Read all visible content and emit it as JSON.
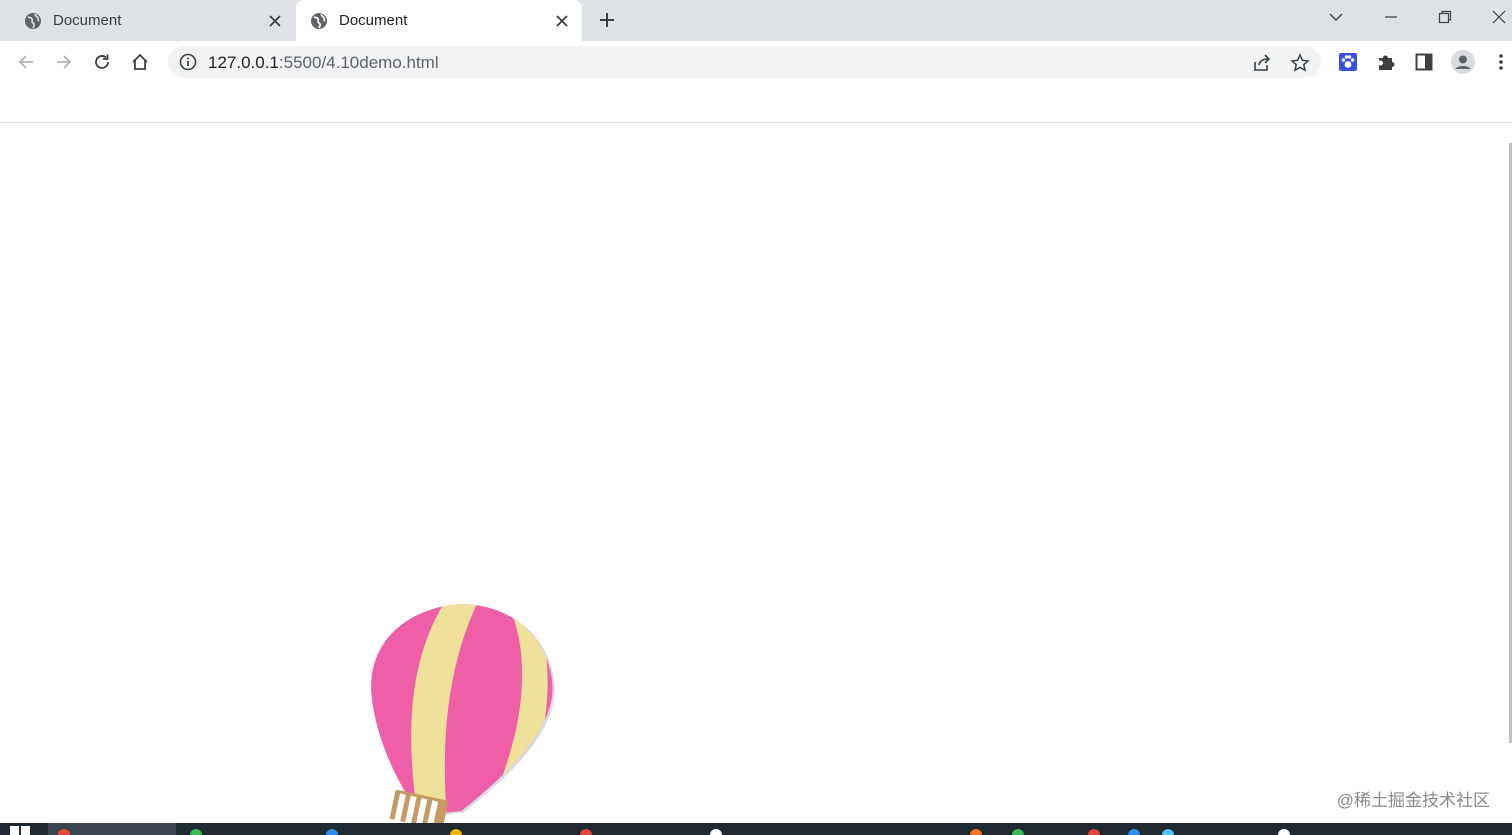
{
  "tabs": [
    {
      "title": "Document",
      "state": "inactive"
    },
    {
      "title": "Document",
      "state": "active"
    }
  ],
  "address_bar": {
    "host": "127.0.0.1",
    "path": ":5500/4.10demo.html"
  },
  "page": {
    "balloon_colors": {
      "pink": "#ef5fa7",
      "cream": "#f0e19a",
      "basket": "#c79a64"
    },
    "watermark": "@稀土掘金技术社区"
  },
  "icons": {
    "favicon": "globe-icon",
    "back": "arrow-left-icon",
    "forward": "arrow-right-icon",
    "reload": "reload-icon",
    "home": "home-icon",
    "site_info": "info-icon",
    "share": "share-icon",
    "bookmark": "star-icon",
    "extension_paw": "paw-icon",
    "extensions": "puzzle-icon",
    "side_panel": "side-panel-icon",
    "profile": "avatar-icon",
    "menu": "kebab-menu-icon"
  },
  "colors": {
    "tabstrip": "#dee1e6",
    "omnibox": "#f1f3f4",
    "taskbar": "#1f2a33"
  }
}
